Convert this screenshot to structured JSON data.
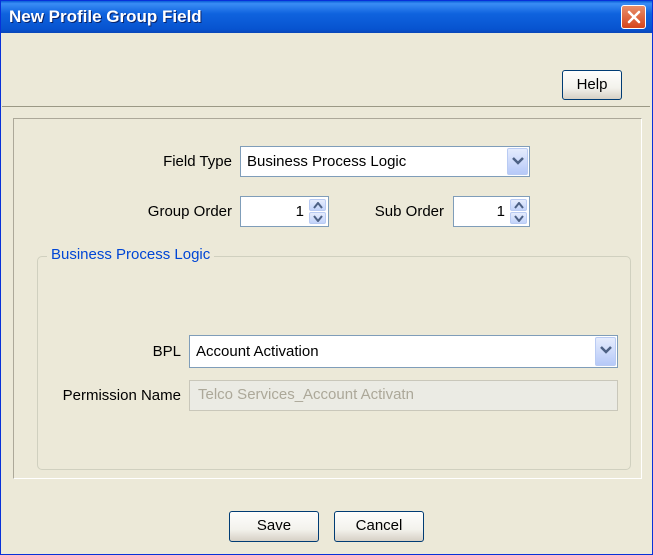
{
  "window": {
    "title": "New Profile Group Field"
  },
  "toolbar": {
    "help_label": "Help"
  },
  "form": {
    "field_type_label": "Field Type",
    "field_type_value": "Business Process Logic",
    "group_order_label": "Group Order",
    "group_order_value": "1",
    "sub_order_label": "Sub Order",
    "sub_order_value": "1"
  },
  "group": {
    "title": "Business Process Logic",
    "bpl_label": "BPL",
    "bpl_value": "Account Activation",
    "permission_label": "Permission Name",
    "permission_value": "Telco Services_Account Activatn"
  },
  "footer": {
    "save_label": "Save",
    "cancel_label": "Cancel"
  },
  "colors": {
    "titlebar": "#0a5fd8",
    "group_title": "#0046d5",
    "close_button": "#d6451c"
  },
  "icons": [
    "close-icon",
    "dropdown-arrow-icon",
    "spin-up-icon",
    "spin-down-icon"
  ]
}
